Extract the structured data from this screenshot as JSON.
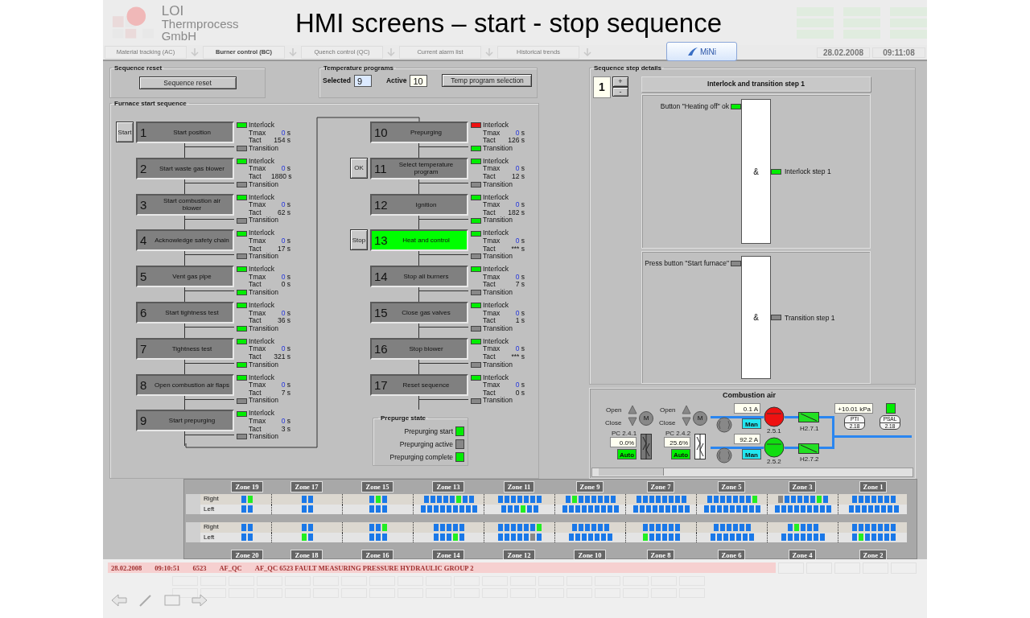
{
  "slide": {
    "title": "HMI screens – start - stop sequence",
    "badge": "MiNi"
  },
  "header": {
    "logo_text": "LOI",
    "company": "Thermprocess GmbH",
    "date": "28.02.2008",
    "time": "09:11:08",
    "tabs": [
      {
        "label": "Material tracking (AC)",
        "selected": false
      },
      {
        "label": "Burner control (BC)",
        "selected": true
      },
      {
        "label": "Quench control (QC)",
        "selected": false
      },
      {
        "label": "Current alarm list",
        "selected": false
      },
      {
        "label": "Historical trends",
        "selected": false
      }
    ]
  },
  "sequence_reset": {
    "title": "Sequence reset",
    "button": "Sequence reset"
  },
  "temperature_programs": {
    "title": "Temperature programs",
    "selected_label": "Selected",
    "selected_value": "9",
    "active_label": "Active",
    "active_value": "10",
    "button": "Temp program selection"
  },
  "furnace_sequence": {
    "title": "Furnace start sequence",
    "columns": [
      {
        "steps": [
          {
            "number": "1",
            "label": "Start position",
            "button": "Start",
            "active": false,
            "interlock_on": true,
            "transition_on": false,
            "interlock_label": "Interlock",
            "tmax_label": "Tmax",
            "tmax": "0",
            "tmax_unit": "s",
            "tact_label": "Tact",
            "tact": "154",
            "tact_unit": "s",
            "transition_label": "Transition"
          },
          {
            "number": "2",
            "label": "Start waste gas blower",
            "active": false,
            "interlock_on": true,
            "transition_on": false,
            "interlock_label": "Interlock",
            "tmax_label": "Tmax",
            "tmax": "0",
            "tmax_unit": "s",
            "tact_label": "Tact",
            "tact": "1880",
            "tact_unit": "s",
            "transition_label": "Transition"
          },
          {
            "number": "3",
            "label": "Start combustion air blower",
            "active": false,
            "interlock_on": true,
            "transition_on": false,
            "interlock_label": "Interlock",
            "tmax_label": "Tmax",
            "tmax": "0",
            "tmax_unit": "s",
            "tact_label": "Tact",
            "tact": "62",
            "tact_unit": "s",
            "transition_label": "Transition"
          },
          {
            "number": "4",
            "label": "Acknowledge safety chain",
            "active": false,
            "interlock_on": true,
            "transition_on": false,
            "interlock_label": "Interlock",
            "tmax_label": "Tmax",
            "tmax": "0",
            "tmax_unit": "s",
            "tact_label": "Tact",
            "tact": "17",
            "tact_unit": "s",
            "transition_label": "Transition"
          },
          {
            "number": "5",
            "label": "Vent gas pipe",
            "active": false,
            "interlock_on": true,
            "transition_on": true,
            "interlock_label": "Interlock",
            "tmax_label": "Tmax",
            "tmax": "0",
            "tmax_unit": "s",
            "tact_label": "Tact",
            "tact": "0",
            "tact_unit": "s",
            "transition_label": "Transition"
          },
          {
            "number": "6",
            "label": "Start tightness test",
            "active": false,
            "interlock_on": true,
            "transition_on": true,
            "interlock_label": "Interlock",
            "tmax_label": "Tmax",
            "tmax": "0",
            "tmax_unit": "s",
            "tact_label": "Tact",
            "tact": "36",
            "tact_unit": "s",
            "transition_label": "Transition"
          },
          {
            "number": "7",
            "label": "Tightness test",
            "active": false,
            "interlock_on": true,
            "transition_on": true,
            "interlock_label": "Interlock",
            "tmax_label": "Tmax",
            "tmax": "0",
            "tmax_unit": "s",
            "tact_label": "Tact",
            "tact": "321",
            "tact_unit": "s",
            "transition_label": "Transition"
          },
          {
            "number": "8",
            "label": "Open combustion air flaps",
            "active": false,
            "interlock_on": true,
            "transition_on": false,
            "interlock_label": "Interlock",
            "tmax_label": "Tmax",
            "tmax": "0",
            "tmax_unit": "s",
            "tact_label": "Tact",
            "tact": "7",
            "tact_unit": "s",
            "transition_label": "Transition"
          },
          {
            "number": "9",
            "label": "Start prepurging",
            "active": false,
            "interlock_on": true,
            "transition_on": false,
            "interlock_label": "Interlock",
            "tmax_label": "Tmax",
            "tmax": "0",
            "tmax_unit": "s",
            "tact_label": "Tact",
            "tact": "3",
            "tact_unit": "s",
            "transition_label": "Transition"
          }
        ]
      },
      {
        "steps": [
          {
            "number": "10",
            "label": "Prepurging",
            "active": false,
            "interlock_on": false,
            "transition_on": true,
            "interlock_label": "Interlock",
            "tmax_label": "Tmax",
            "tmax": "0",
            "tmax_unit": "s",
            "tact_label": "Tact",
            "tact": "126",
            "tact_unit": "s",
            "transition_label": "Transition"
          },
          {
            "number": "11",
            "label": "Select temperature program",
            "button": "OK",
            "active": false,
            "interlock_on": true,
            "transition_on": false,
            "interlock_label": "Interlock",
            "tmax_label": "Tmax",
            "tmax": "0",
            "tmax_unit": "s",
            "tact_label": "Tact",
            "tact": "12",
            "tact_unit": "s",
            "transition_label": "Transition"
          },
          {
            "number": "12",
            "label": "Ignition",
            "active": false,
            "interlock_on": true,
            "transition_on": true,
            "interlock_label": "Interlock",
            "tmax_label": "Tmax",
            "tmax": "0",
            "tmax_unit": "s",
            "tact_label": "Tact",
            "tact": "182",
            "tact_unit": "s",
            "transition_label": "Transition"
          },
          {
            "number": "13",
            "label": "Heat and control",
            "button": "Stop",
            "active": true,
            "interlock_on": true,
            "transition_on": false,
            "interlock_label": "Interlock",
            "tmax_label": "Tmax",
            "tmax": "0",
            "tmax_unit": "s",
            "tact_label": "Tact",
            "tact": "***",
            "tact_unit": "s",
            "transition_label": "Transition"
          },
          {
            "number": "14",
            "label": "Stop all burners",
            "active": false,
            "interlock_on": true,
            "transition_on": false,
            "interlock_label": "Interlock",
            "tmax_label": "Tmax",
            "tmax": "0",
            "tmax_unit": "s",
            "tact_label": "Tact",
            "tact": "7",
            "tact_unit": "s",
            "transition_label": "Transition"
          },
          {
            "number": "15",
            "label": "Close gas valves",
            "active": false,
            "interlock_on": true,
            "transition_on": false,
            "interlock_label": "Interlock",
            "tmax_label": "Tmax",
            "tmax": "0",
            "tmax_unit": "s",
            "tact_label": "Tact",
            "tact": "1",
            "tact_unit": "s",
            "transition_label": "Transition"
          },
          {
            "number": "16",
            "label": "Stop blower",
            "active": false,
            "interlock_on": true,
            "transition_on": false,
            "interlock_label": "Interlock",
            "tmax_label": "Tmax",
            "tmax": "0",
            "tmax_unit": "s",
            "tact_label": "Tact",
            "tact": "***",
            "tact_unit": "s",
            "transition_label": "Transition"
          },
          {
            "number": "17",
            "label": "Reset sequence",
            "active": false,
            "interlock_on": true,
            "transition_on": false,
            "interlock_label": "Interlock",
            "tmax_label": "Tmax",
            "tmax": "0",
            "tmax_unit": "s",
            "tact_label": "Tact",
            "tact": "0",
            "tact_unit": "s",
            "transition_label": "Transition"
          }
        ]
      }
    ]
  },
  "prepurge_state": {
    "title": "Prepurge state",
    "items": [
      {
        "label": "Prepurging start",
        "on": true
      },
      {
        "label": "Prepurging active",
        "on": false
      },
      {
        "label": "Prepurging complete",
        "on": true
      }
    ]
  },
  "step_details": {
    "title": "Sequence step details",
    "step": "1",
    "plus": "+",
    "minus": "-",
    "header": "Interlock and transition step 1",
    "logic": [
      {
        "input_label": "Button \"Heating off\" ok",
        "input_on": true,
        "gate": "&",
        "output_label": "Interlock step 1",
        "output_on": true
      },
      {
        "input_label": "Press button \"Start furnace\"",
        "input_on": false,
        "gate": "&",
        "output_label": "Transition step 1",
        "output_on": false
      }
    ]
  },
  "combustion_air": {
    "title": "Combustion air",
    "dampers": [
      {
        "open_label": "Open",
        "close_label": "Close",
        "motor": "M",
        "tag": "PC 2.4.1",
        "value": "0.0%",
        "mode": "Auto",
        "shaded": true
      },
      {
        "open_label": "Open",
        "close_label": "Close",
        "motor": "M",
        "tag": "PC 2.4.2",
        "value": "25.6%",
        "mode": "Auto",
        "shaded": false
      }
    ],
    "blowers": [
      {
        "current": "0.1 A",
        "mode": "Man",
        "tag": "2.5.1",
        "running": false,
        "valve": "H2.7.1"
      },
      {
        "current": "92.2 A",
        "mode": "Man",
        "tag": "2.5.2",
        "running": true,
        "valve": "H2.7.2"
      }
    ],
    "pressure": "+10.01 kPa",
    "pti": {
      "name": "PTI",
      "number": "2.18"
    },
    "psal": {
      "name": "PSAL",
      "number": "2.18",
      "on": true
    }
  },
  "zones": {
    "row_labels": [
      "Right",
      "Left",
      "Right",
      "Left"
    ],
    "columns": [
      {
        "top": "Zone 19",
        "bottom": "Zone 20",
        "rows": [
          [
            {
              "color": "#1a78e8"
            },
            {
              "color": "#22ee22"
            }
          ],
          [
            {
              "color": "#1a78e8"
            },
            {
              "color": "#1a78e8"
            }
          ],
          [
            {
              "color": "#1a78e8"
            },
            {
              "color": "#1a78e8"
            }
          ],
          [
            {
              "color": "#1a78e8"
            },
            {
              "color": "#1a78e8"
            }
          ]
        ]
      },
      {
        "top": "Zone 17",
        "bottom": "Zone 18",
        "rows": [
          [
            {
              "color": "#1a78e8"
            },
            {
              "color": "#1a78e8"
            }
          ],
          [
            {
              "color": "#1a78e8"
            },
            {
              "color": "#1a78e8"
            }
          ],
          [
            {
              "color": "#1a78e8"
            },
            {
              "color": "#1a78e8"
            }
          ],
          [
            {
              "color": "#22ee22"
            },
            {
              "color": "#1a78e8"
            }
          ]
        ]
      },
      {
        "top": "Zone 15",
        "bottom": "Zone 16",
        "rows": [
          [
            {
              "color": "#1a78e8"
            },
            {
              "color": "#22ee22"
            },
            {
              "color": "#1a78e8"
            }
          ],
          [
            {
              "color": "#1a78e8"
            },
            {
              "color": "#1a78e8"
            },
            {
              "color": "#1a78e8"
            }
          ],
          [
            {
              "color": "#1a78e8"
            },
            {
              "color": "#1a78e8"
            },
            {
              "color": "#22ee22"
            }
          ],
          [
            {
              "color": "#1a78e8"
            },
            {
              "color": "#1a78e8"
            },
            {
              "color": "#1a78e8"
            }
          ]
        ]
      },
      {
        "top": "Zone 13",
        "bottom": "Zone 14",
        "rows": [
          [
            {
              "color": "#1a78e8"
            },
            {
              "color": "#1a78e8"
            },
            {
              "color": "#1a78e8"
            },
            {
              "color": "#1a78e8"
            },
            {
              "color": "#1a78e8"
            },
            {
              "color": "#22ee22"
            },
            {
              "color": "#1a78e8"
            },
            {
              "color": "#1a78e8"
            }
          ],
          [
            {
              "color": "#1a78e8"
            },
            {
              "color": "#1a78e8"
            },
            {
              "color": "#1a78e8"
            },
            {
              "color": "#1a78e8"
            },
            {
              "color": "#1a78e8"
            },
            {
              "color": "#1a78e8"
            },
            {
              "color": "#1a78e8"
            },
            {
              "color": "#1a78e8"
            },
            {
              "color": "#1a78e8"
            }
          ],
          [
            {
              "color": "#1a78e8"
            },
            {
              "color": "#1a78e8"
            },
            {
              "color": "#1a78e8"
            },
            {
              "color": "#1a78e8"
            },
            {
              "color": "#1a78e8"
            }
          ],
          [
            {
              "color": "#1a78e8"
            },
            {
              "color": "#1a78e8"
            },
            {
              "color": "#1a78e8"
            },
            {
              "color": "#22ee22"
            },
            {
              "color": "#1a78e8"
            }
          ]
        ]
      },
      {
        "top": "Zone 11",
        "bottom": "Zone 12",
        "rows": [
          [
            {
              "color": "#1a78e8"
            },
            {
              "color": "#1a78e8"
            },
            {
              "color": "#1a78e8"
            },
            {
              "color": "#1a78e8"
            },
            {
              "color": "#1a78e8"
            },
            {
              "color": "#1a78e8"
            },
            {
              "color": "#1a78e8"
            }
          ],
          [
            {
              "color": "#1a78e8"
            },
            {
              "color": "#1a78e8"
            },
            {
              "color": "#1a78e8"
            },
            {
              "color": "#22ee22"
            },
            {
              "color": "#1a78e8"
            },
            {
              "color": "#1a78e8"
            }
          ],
          [
            {
              "color": "#1a78e8"
            },
            {
              "color": "#1a78e8"
            },
            {
              "color": "#1a78e8"
            },
            {
              "color": "#1a78e8"
            },
            {
              "color": "#1a78e8"
            },
            {
              "color": "#1a78e8"
            },
            {
              "color": "#22ee22"
            }
          ],
          [
            {
              "color": "#1a78e8"
            },
            {
              "color": "#1a78e8"
            },
            {
              "color": "#1a78e8"
            },
            {
              "color": "#1a78e8"
            },
            {
              "color": "#1a78e8"
            },
            {
              "color": "#888888"
            },
            {
              "color": "#1a78e8"
            }
          ]
        ]
      },
      {
        "top": "Zone 9",
        "bottom": "Zone 10",
        "rows": [
          [
            {
              "color": "#1a78e8"
            },
            {
              "color": "#22ee22"
            },
            {
              "color": "#1a78e8"
            },
            {
              "color": "#1a78e8"
            },
            {
              "color": "#1a78e8"
            },
            {
              "color": "#1a78e8"
            },
            {
              "color": "#1a78e8"
            },
            {
              "color": "#1a78e8"
            }
          ],
          [
            {
              "color": "#1a78e8"
            },
            {
              "color": "#1a78e8"
            },
            {
              "color": "#1a78e8"
            },
            {
              "color": "#1a78e8"
            },
            {
              "color": "#1a78e8"
            },
            {
              "color": "#1a78e8"
            },
            {
              "color": "#1a78e8"
            },
            {
              "color": "#1a78e8"
            },
            {
              "color": "#1a78e8"
            }
          ],
          [
            {
              "color": "#1a78e8"
            },
            {
              "color": "#1a78e8"
            },
            {
              "color": "#1a78e8"
            },
            {
              "color": "#1a78e8"
            },
            {
              "color": "#1a78e8"
            },
            {
              "color": "#1a78e8"
            }
          ],
          [
            {
              "color": "#1a78e8"
            },
            {
              "color": "#1a78e8"
            },
            {
              "color": "#1a78e8"
            },
            {
              "color": "#1a78e8"
            },
            {
              "color": "#1a78e8"
            },
            {
              "color": "#1a78e8"
            },
            {
              "color": "#1a78e8"
            }
          ]
        ]
      },
      {
        "top": "Zone 7",
        "bottom": "Zone 8",
        "rows": [
          [
            {
              "color": "#1a78e8"
            },
            {
              "color": "#1a78e8"
            },
            {
              "color": "#1a78e8"
            },
            {
              "color": "#1a78e8"
            },
            {
              "color": "#1a78e8"
            },
            {
              "color": "#1a78e8"
            },
            {
              "color": "#1a78e8"
            },
            {
              "color": "#1a78e8"
            }
          ],
          [
            {
              "color": "#1a78e8"
            },
            {
              "color": "#1a78e8"
            },
            {
              "color": "#1a78e8"
            },
            {
              "color": "#1a78e8"
            },
            {
              "color": "#1a78e8"
            },
            {
              "color": "#1a78e8"
            },
            {
              "color": "#1a78e8"
            },
            {
              "color": "#1a78e8"
            },
            {
              "color": "#1a78e8"
            }
          ],
          [
            {
              "color": "#1a78e8"
            },
            {
              "color": "#1a78e8"
            },
            {
              "color": "#1a78e8"
            },
            {
              "color": "#1a78e8"
            },
            {
              "color": "#1a78e8"
            },
            {
              "color": "#1a78e8"
            }
          ],
          [
            {
              "color": "#22ee22"
            },
            {
              "color": "#1a78e8"
            },
            {
              "color": "#1a78e8"
            },
            {
              "color": "#1a78e8"
            },
            {
              "color": "#1a78e8"
            },
            {
              "color": "#1a78e8"
            }
          ]
        ]
      },
      {
        "top": "Zone 5",
        "bottom": "Zone 6",
        "rows": [
          [
            {
              "color": "#1a78e8"
            },
            {
              "color": "#1a78e8"
            },
            {
              "color": "#1a78e8"
            },
            {
              "color": "#1a78e8"
            },
            {
              "color": "#1a78e8"
            },
            {
              "color": "#1a78e8"
            },
            {
              "color": "#1a78e8"
            },
            {
              "color": "#22ee22"
            }
          ],
          [
            {
              "color": "#1a78e8"
            },
            {
              "color": "#1a78e8"
            },
            {
              "color": "#1a78e8"
            },
            {
              "color": "#1a78e8"
            },
            {
              "color": "#1a78e8"
            },
            {
              "color": "#1a78e8"
            },
            {
              "color": "#1a78e8"
            },
            {
              "color": "#1a78e8"
            },
            {
              "color": "#1a78e8"
            }
          ],
          [
            {
              "color": "#1a78e8"
            },
            {
              "color": "#1a78e8"
            },
            {
              "color": "#1a78e8"
            },
            {
              "color": "#1a78e8"
            },
            {
              "color": "#1a78e8"
            },
            {
              "color": "#1a78e8"
            }
          ],
          [
            {
              "color": "#1a78e8"
            },
            {
              "color": "#1a78e8"
            },
            {
              "color": "#1a78e8"
            },
            {
              "color": "#1a78e8"
            },
            {
              "color": "#1a78e8"
            },
            {
              "color": "#1a78e8"
            },
            {
              "color": "#1a78e8"
            }
          ]
        ]
      },
      {
        "top": "Zone 3",
        "bottom": "Zone 4",
        "rows": [
          [
            {
              "color": "#888888"
            },
            {
              "color": "#1a78e8"
            },
            {
              "color": "#1a78e8"
            },
            {
              "color": "#1a78e8"
            },
            {
              "color": "#1a78e8"
            },
            {
              "color": "#1a78e8"
            },
            {
              "color": "#22ee22"
            },
            {
              "color": "#1a78e8"
            }
          ],
          [
            {
              "color": "#1a78e8"
            },
            {
              "color": "#1a78e8"
            },
            {
              "color": "#1a78e8"
            },
            {
              "color": "#1a78e8"
            },
            {
              "color": "#1a78e8"
            },
            {
              "color": "#1a78e8"
            },
            {
              "color": "#1a78e8"
            },
            {
              "color": "#1a78e8"
            },
            {
              "color": "#1a78e8"
            }
          ],
          [
            {
              "color": "#1a78e8"
            },
            {
              "color": "#22ee22"
            },
            {
              "color": "#1a78e8"
            },
            {
              "color": "#1a78e8"
            },
            {
              "color": "#1a78e8"
            }
          ],
          [
            {
              "color": "#1a78e8"
            },
            {
              "color": "#1a78e8"
            },
            {
              "color": "#1a78e8"
            },
            {
              "color": "#1a78e8"
            },
            {
              "color": "#1a78e8"
            },
            {
              "color": "#1a78e8"
            },
            {
              "color": "#1a78e8"
            }
          ]
        ]
      },
      {
        "top": "Zone 1",
        "bottom": "Zone 2",
        "rows": [
          [
            {
              "color": "#1a78e8"
            },
            {
              "color": "#1a78e8"
            },
            {
              "color": "#1a78e8"
            },
            {
              "color": "#1a78e8"
            },
            {
              "color": "#1a78e8"
            },
            {
              "color": "#1a78e8"
            },
            {
              "color": "#1a78e8"
            }
          ],
          [
            {
              "color": "#1a78e8"
            },
            {
              "color": "#1a78e8"
            },
            {
              "color": "#1a78e8"
            },
            {
              "color": "#1a78e8"
            },
            {
              "color": "#1a78e8"
            },
            {
              "color": "#1a78e8"
            },
            {
              "color": "#1a78e8"
            },
            {
              "color": "#1a78e8"
            }
          ],
          [
            {
              "color": "#1a78e8"
            },
            {
              "color": "#1a78e8"
            },
            {
              "color": "#1a78e8"
            },
            {
              "color": "#1a78e8"
            },
            {
              "color": "#1a78e8"
            },
            {
              "color": "#1a78e8"
            },
            {
              "color": "#1a78e8"
            }
          ],
          [
            {
              "color": "#1a78e8"
            },
            {
              "color": "#22ee22"
            },
            {
              "color": "#1a78e8"
            },
            {
              "color": "#1a78e8"
            },
            {
              "color": "#1a78e8"
            },
            {
              "color": "#1a78e8"
            },
            {
              "color": "#1a78e8"
            }
          ]
        ]
      }
    ]
  },
  "alarm": [
    "28.02.2008",
    "09:10:51",
    "6523",
    "AF_QC",
    "AF_QC 6523 FAULT MEASURING PRESSURE HYDRAULIC GROUP 2"
  ]
}
